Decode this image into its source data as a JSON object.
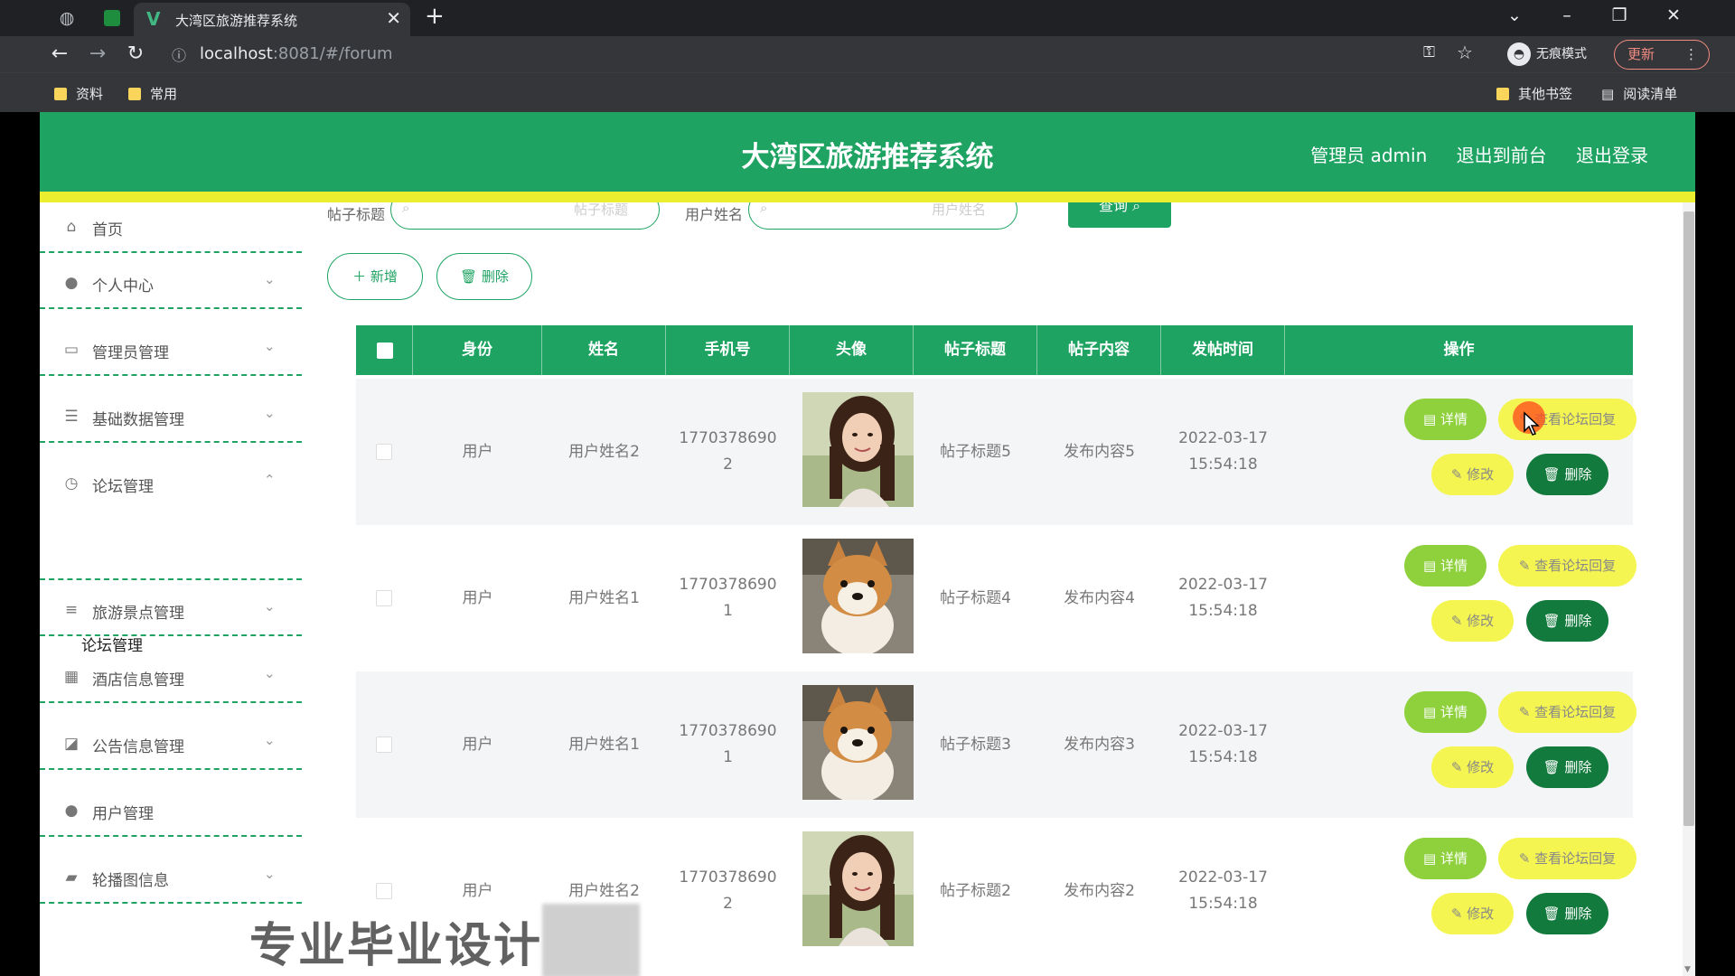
{
  "browser": {
    "tab_title": "大湾区旅游推荐系统",
    "tab_favicon": "V",
    "new_tab": "+",
    "close_tab": "✕",
    "url_host": "localhost",
    "url_path": ":8081/#/forum",
    "incognito_label": "无痕模式",
    "update_label": "更新",
    "bookmarks": [
      "资料",
      "常用"
    ],
    "bookmarks_right": [
      "其他书签",
      "阅读清单"
    ]
  },
  "header": {
    "title": "大湾区旅游推荐系统",
    "links": [
      "管理员 admin",
      "退出到前台",
      "退出登录"
    ]
  },
  "colors": {
    "primary": "#1ea362",
    "accent_yellow": "#eaee2e",
    "delete_dark": "#127a3c",
    "detail_green": "#8ed13d",
    "reply_yellow": "#f5f552"
  },
  "sidebar": {
    "items": [
      {
        "label": "首页",
        "icon": "home-icon"
      },
      {
        "label": "个人中心",
        "icon": "user-icon"
      },
      {
        "label": "管理员管理",
        "icon": "admin-icon"
      },
      {
        "label": "基础数据管理",
        "icon": "sliders-icon"
      },
      {
        "label": "论坛管理",
        "icon": "compass-icon"
      },
      {
        "label": "旅游景点管理",
        "icon": "list-icon"
      },
      {
        "label": "酒店信息管理",
        "icon": "grid-icon"
      },
      {
        "label": "公告信息管理",
        "icon": "chart-icon"
      },
      {
        "label": "用户管理",
        "icon": "user-icon"
      },
      {
        "label": "轮播图信息",
        "icon": "picture-icon"
      }
    ],
    "submenu_active": "论坛管理"
  },
  "search": {
    "title_label": "帖子标题",
    "title_placeholder": "帖子标题",
    "user_label": "用户姓名",
    "user_placeholder": "用户姓名",
    "query_button": "查询"
  },
  "actions": {
    "add": "新增",
    "delete": "删除"
  },
  "table": {
    "columns": [
      "身份",
      "姓名",
      "手机号",
      "头像",
      "帖子标题",
      "帖子内容",
      "发帖时间",
      "操作"
    ],
    "row_buttons": {
      "detail": "详情",
      "reply": "查看论坛回复",
      "edit": "修改",
      "delete": "删除"
    },
    "rows": [
      {
        "identity": "用户",
        "name": "用户姓名2",
        "phone_a": "1770378690",
        "phone_b": "2",
        "avatar": "woman-photo",
        "title": "帖子标题5",
        "content": "发布内容5",
        "date": "2022-03-17",
        "time": "15:54:18"
      },
      {
        "identity": "用户",
        "name": "用户姓名1",
        "phone_a": "1770378690",
        "phone_b": "1",
        "avatar": "dog-photo",
        "title": "帖子标题4",
        "content": "发布内容4",
        "date": "2022-03-17",
        "time": "15:54:18"
      },
      {
        "identity": "用户",
        "name": "用户姓名1",
        "phone_a": "1770378690",
        "phone_b": "1",
        "avatar": "dog-photo",
        "title": "帖子标题3",
        "content": "发布内容3",
        "date": "2022-03-17",
        "time": "15:54:18"
      },
      {
        "identity": "用户",
        "name": "用户姓名2",
        "phone_a": "1770378690",
        "phone_b": "2",
        "avatar": "woman-photo",
        "title": "帖子标题2",
        "content": "发布内容2",
        "date": "2022-03-17",
        "time": "15:54:18"
      }
    ]
  },
  "overlay": {
    "watermark": "专业毕业设计"
  }
}
